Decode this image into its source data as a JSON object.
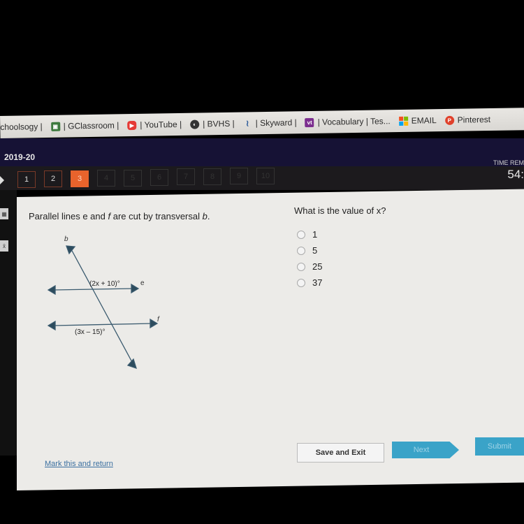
{
  "bookmarks": [
    {
      "label": "chools​ogy |",
      "icon": "schoology-icon",
      "color": ""
    },
    {
      "label": "| GClassroom |",
      "icon": "gclassroom-icon",
      "color": "#3d7a3d"
    },
    {
      "label": "| YouTube |",
      "icon": "youtube-icon",
      "color": "#e53935"
    },
    {
      "label": "| BVHS |",
      "icon": "globe-icon",
      "color": "#333333"
    },
    {
      "label": "| Skyward |",
      "icon": "skyward-icon",
      "color": "#2a5a9a"
    },
    {
      "label": "| Vocabulary | Tes...",
      "icon": "vocabulary-icon",
      "color": "#7b2d8e"
    },
    {
      "label": "EMAIL",
      "icon": "microsoft-icon",
      "color": ""
    },
    {
      "label": "Pinterest",
      "icon": "pinterest-icon",
      "color": "#e0412b"
    }
  ],
  "header": {
    "course": "2019-20",
    "timer_label": "TIME REM",
    "timer_value": "54:"
  },
  "questions": {
    "numbers": [
      "1",
      "2",
      "3",
      "4",
      "5",
      "6",
      "7",
      "8",
      "9",
      "10"
    ],
    "current": 3
  },
  "content": {
    "prompt_html": "Parallel lines e and f are cut by transversal b.",
    "question": "What is the value of x?",
    "choices": [
      "1",
      "5",
      "25",
      "37"
    ],
    "diagram": {
      "label_b": "b",
      "label_e": "e",
      "label_f": "f",
      "angle_top": "(2x + 10)°",
      "angle_bottom": "(3x – 15)°"
    }
  },
  "footer": {
    "mark_link": "Mark this and return",
    "save_exit": "Save and Exit",
    "next": "Next",
    "submit": "Submit"
  },
  "colors": {
    "accent_orange": "#e8632c",
    "button_blue": "#3aa3c8",
    "line_color": "#3a5a6e"
  }
}
